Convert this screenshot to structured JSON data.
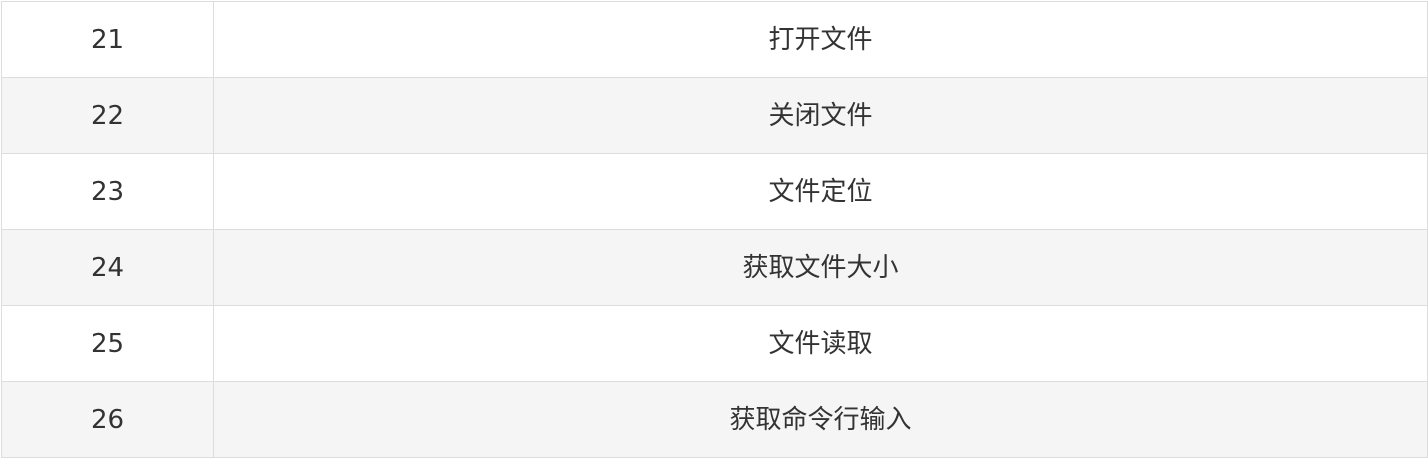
{
  "table": {
    "rows": [
      {
        "num": "21",
        "func": "打开文件"
      },
      {
        "num": "22",
        "func": "关闭文件"
      },
      {
        "num": "23",
        "func": "文件定位"
      },
      {
        "num": "24",
        "func": "获取文件大小"
      },
      {
        "num": "25",
        "func": "文件读取"
      },
      {
        "num": "26",
        "func": "获取命令行输入"
      }
    ]
  }
}
